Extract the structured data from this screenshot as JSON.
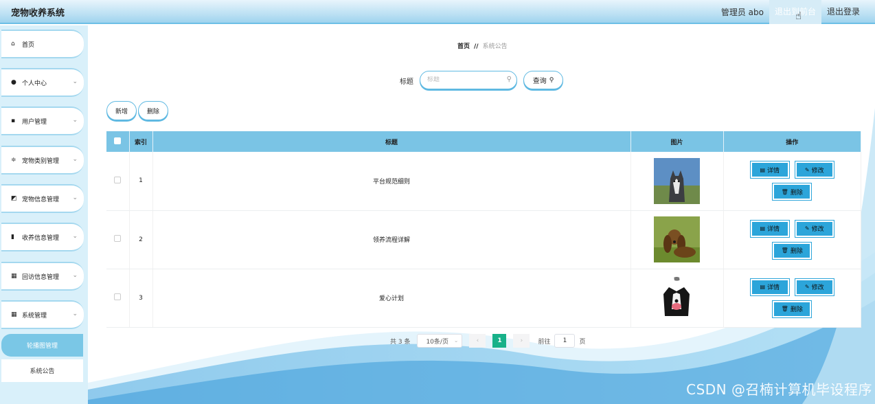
{
  "header": {
    "title": "宠物收养系统",
    "admin": "管理员 abo",
    "exit_to_front": "退出到前台",
    "logout": "退出登录"
  },
  "sidebar": {
    "items": [
      {
        "label": "首页",
        "icon": "home-icon"
      },
      {
        "label": "个人中心",
        "icon": "user-icon"
      },
      {
        "label": "用户管理",
        "icon": "briefcase-icon"
      },
      {
        "label": "宠物类别管理",
        "icon": "sliders-icon"
      },
      {
        "label": "宠物信息管理",
        "icon": "chart-icon"
      },
      {
        "label": "收养信息管理",
        "icon": "bars-icon"
      },
      {
        "label": "回访信息管理",
        "icon": "grid-icon"
      },
      {
        "label": "系统管理",
        "icon": "grid-icon"
      }
    ],
    "sub_items": [
      {
        "label": "轮播图管理",
        "active": true
      },
      {
        "label": "系统公告",
        "active": false
      }
    ]
  },
  "breadcrumb": {
    "home": "首页",
    "separator": "//",
    "current": "系统公告"
  },
  "search": {
    "label": "标题",
    "placeholder": "标题",
    "value": "",
    "button": "查询"
  },
  "actions": {
    "add": "新增",
    "delete": "删除"
  },
  "table": {
    "headers": [
      "索引",
      "标题",
      "图片",
      "操作"
    ],
    "rows": [
      {
        "index": "1",
        "title": "平台规范细则",
        "image": "husky-photo"
      },
      {
        "index": "2",
        "title": "领养流程详解",
        "image": "spaniel-photo"
      },
      {
        "index": "3",
        "title": "爱心计划",
        "image": "border-collie-photo"
      }
    ],
    "row_actions": {
      "detail": "详情",
      "edit": "修改",
      "delete": "删除"
    }
  },
  "pagination": {
    "total": "共 3 条",
    "page_size": "10条/页",
    "current_page": "1",
    "goto_label": "前往",
    "goto_value": "1",
    "page_suffix": "页"
  },
  "watermark": "CSDN @召楠计算机毕设程序",
  "colors": {
    "header_bg": "#b6def2",
    "table_header": "#7ac4e5",
    "button_blue": "#2ca5da",
    "page_active": "#17b189",
    "sidebar_bg": "#d9f0fa"
  }
}
